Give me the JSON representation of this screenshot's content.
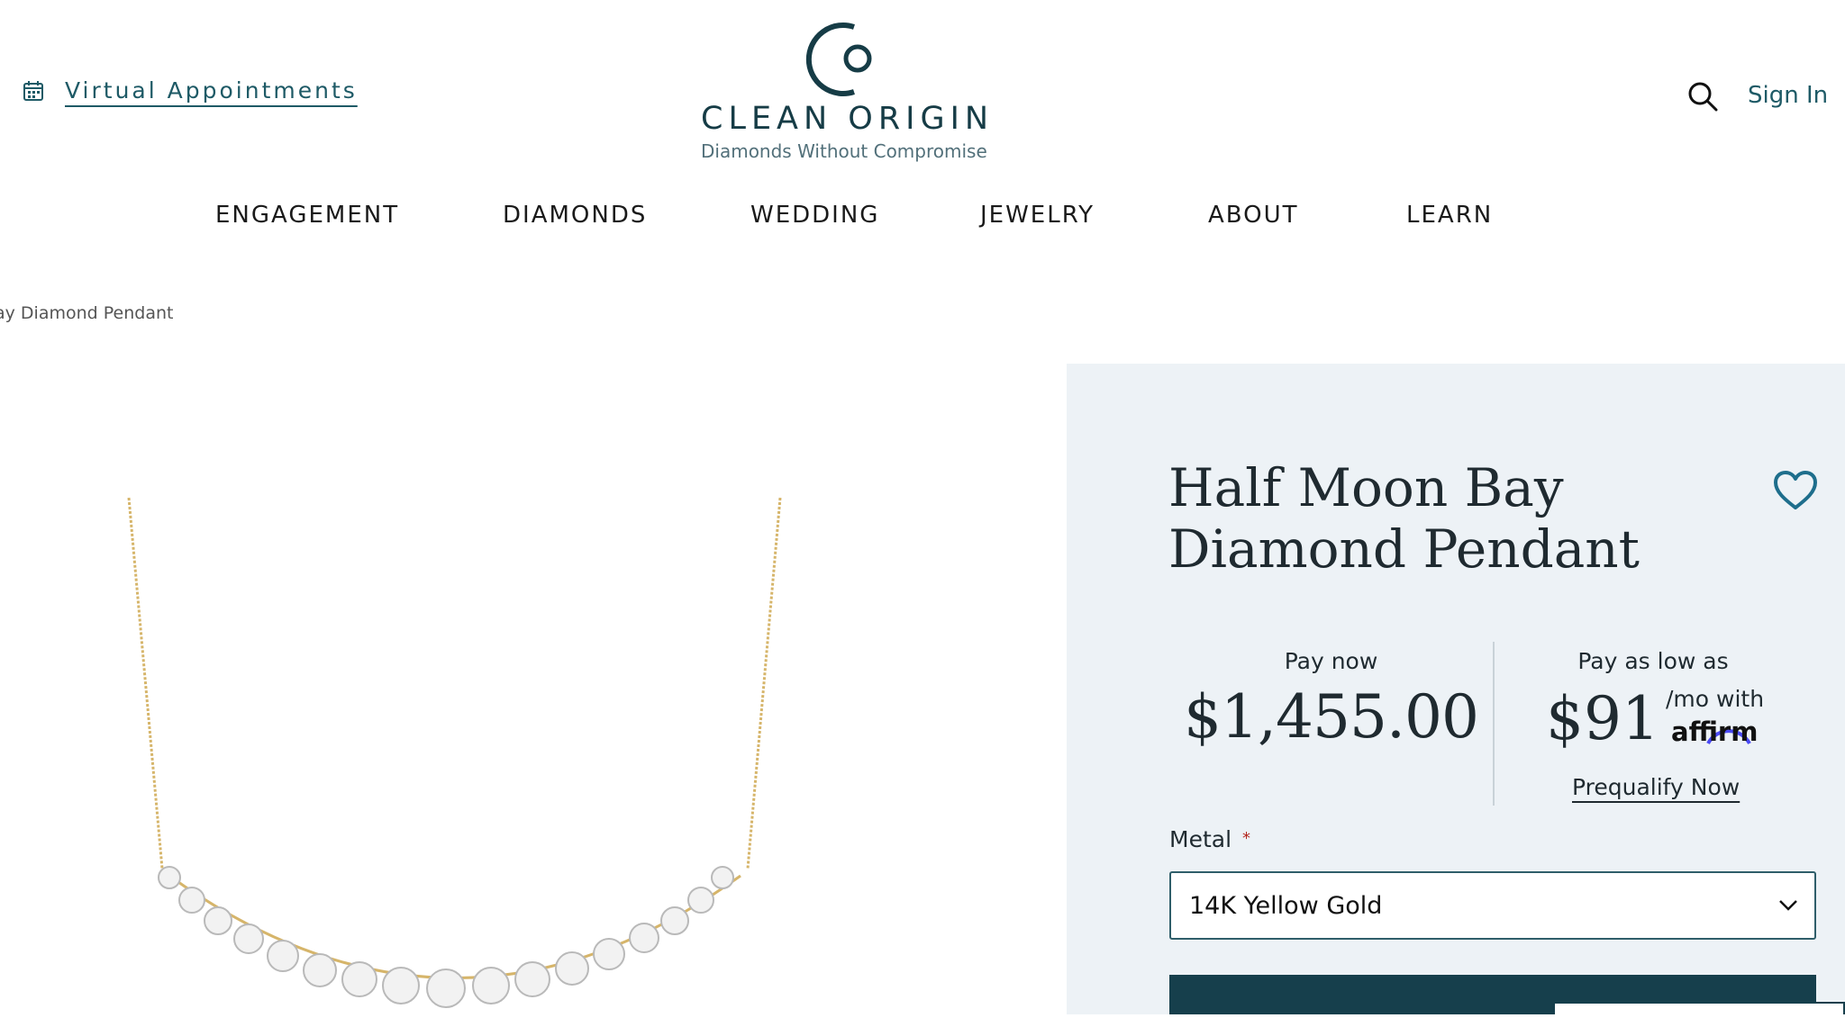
{
  "header": {
    "virtual_appointments": "Virtual Appointments",
    "brand_name": "CLEAN ORIGIN",
    "tagline": "Diamonds Without Compromise",
    "sign_in": "Sign In"
  },
  "nav": {
    "items": [
      "ENGAGEMENT",
      "DIAMONDS",
      "WEDDING",
      "JEWELRY",
      "ABOUT",
      "LEARN"
    ]
  },
  "breadcrumb": {
    "current": "ay Diamond Pendant"
  },
  "product": {
    "title_line1": "Half Moon Bay",
    "title_line2": "Diamond Pendant",
    "pay_now_label": "Pay now",
    "pay_now_price": "$1,455.00",
    "pay_low_label": "Pay as low as",
    "monthly_price": "$91",
    "per_month_with": "/mo with",
    "financing_brand": "affirm",
    "prequalify": "Prequalify Now",
    "metal_label": "Metal",
    "required_marker": "*",
    "metal_selected": "14K Yellow Gold"
  },
  "colors": {
    "accent": "#1e5a66",
    "brand_dark": "#163c46",
    "panel_bg": "#edf2f6",
    "cta_bg": "#163f4c",
    "affirm_arc": "#4a4af4",
    "gold_chain": "#d6b56a"
  },
  "icons": {
    "calendar": "calendar-icon",
    "search": "search-icon",
    "heart": "heart-icon",
    "chevron": "chevron-down-icon"
  }
}
